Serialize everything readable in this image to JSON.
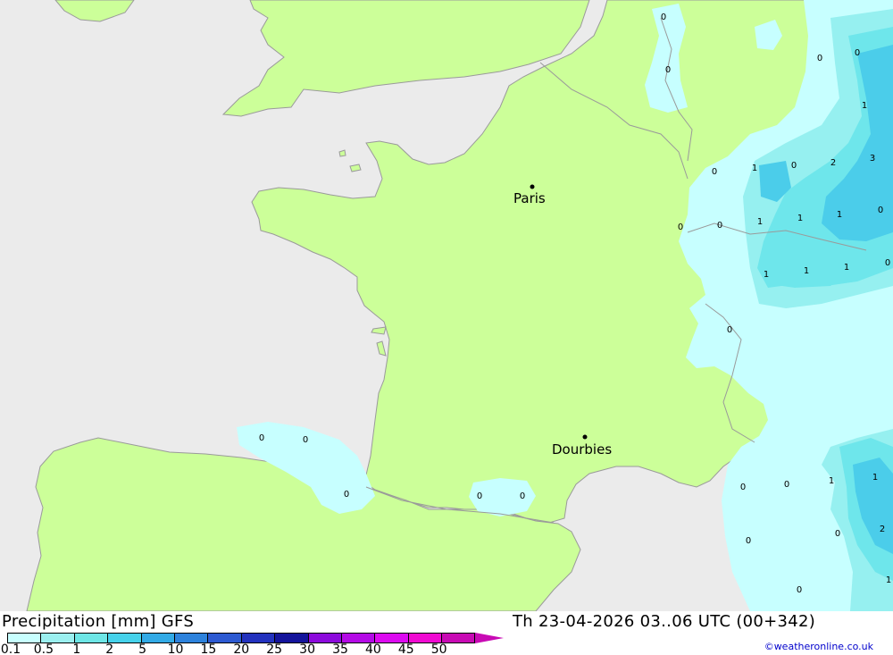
{
  "map": {
    "cities": [
      {
        "name": "Paris"
      },
      {
        "name": "Dourbies"
      }
    ],
    "values": [
      "0",
      "0",
      "0",
      "0",
      "1",
      "0",
      "2",
      "3",
      "0",
      "1",
      "0",
      "0",
      "1",
      "1",
      "1",
      "0",
      "1",
      "1",
      "1",
      "0",
      "0",
      "0",
      "0",
      "0",
      "0",
      "0",
      "0",
      "0",
      "1",
      "1",
      "0",
      "2",
      "0",
      "0",
      "1"
    ],
    "colors": {
      "sea": "#ebebeb",
      "land": "#ccff99",
      "precip_01": "#c7ffff",
      "precip_05": "#96f0f0",
      "precip_1": "#6ee6eb",
      "precip_2": "#4bcdea"
    }
  },
  "footer": {
    "title_left": "Precipitation [mm] GFS",
    "title_right": "Th 23-04-2026 03..06 UTC (00+342)",
    "credit": "©weatheronline.co.uk"
  },
  "colorbar": {
    "labels": [
      "0.1",
      "0.5",
      "1",
      "2",
      "5",
      "10",
      "15",
      "20",
      "25",
      "30",
      "35",
      "40",
      "45",
      "50"
    ],
    "colors": [
      "#c8ffff",
      "#9befef",
      "#6ee6e6",
      "#46d2eb",
      "#32aae6",
      "#2d82dc",
      "#2d5ad2",
      "#2332be",
      "#14149b",
      "#8c0adc",
      "#b40ae6",
      "#dc0af0",
      "#f00ad2",
      "#c80ab4"
    ]
  }
}
